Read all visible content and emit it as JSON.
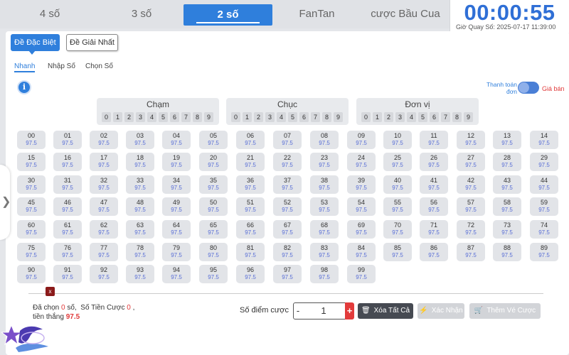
{
  "tabs": [
    "4 số",
    "3 số",
    "2 số",
    "FanTan",
    "cược Bầu Cua"
  ],
  "active_tab": "2 số",
  "timer": {
    "countdown": "00:00:55",
    "draw_time_label": "Giờ Quay Số: 2025-07-17 11:39:00"
  },
  "bet_types": {
    "special": "Đề Đặc Biệt",
    "first": "Đề Giải Nhất"
  },
  "sub_tabs": {
    "quick": "Nhanh",
    "enter": "Nhập Số",
    "choose": "Chọn Số"
  },
  "info_icon": "i",
  "payment": {
    "left_label": "Thanh toán đơn",
    "right_label": "Giá bán"
  },
  "digit_groups": [
    {
      "title": "Chạm",
      "digits": [
        "0",
        "1",
        "2",
        "3",
        "4",
        "5",
        "6",
        "7",
        "8",
        "9"
      ]
    },
    {
      "title": "Chục",
      "digits": [
        "0",
        "1",
        "2",
        "3",
        "4",
        "5",
        "6",
        "7",
        "8",
        "9"
      ]
    },
    {
      "title": "Đơn vị",
      "digits": [
        "0",
        "1",
        "2",
        "3",
        "4",
        "5",
        "6",
        "7",
        "8",
        "9"
      ]
    }
  ],
  "numbers": [
    "00",
    "01",
    "02",
    "03",
    "04",
    "05",
    "06",
    "07",
    "08",
    "09",
    "10",
    "11",
    "12",
    "13",
    "14",
    "15",
    "16",
    "17",
    "18",
    "19",
    "20",
    "21",
    "22",
    "23",
    "24",
    "25",
    "26",
    "27",
    "28",
    "29",
    "30",
    "31",
    "32",
    "33",
    "34",
    "35",
    "36",
    "37",
    "38",
    "39",
    "40",
    "41",
    "42",
    "43",
    "44",
    "45",
    "46",
    "47",
    "48",
    "49",
    "50",
    "51",
    "52",
    "53",
    "54",
    "55",
    "56",
    "57",
    "58",
    "59",
    "60",
    "61",
    "62",
    "63",
    "64",
    "65",
    "66",
    "67",
    "68",
    "69",
    "70",
    "71",
    "72",
    "73",
    "74",
    "75",
    "76",
    "77",
    "78",
    "79",
    "80",
    "81",
    "82",
    "83",
    "84",
    "85",
    "86",
    "87",
    "88",
    "89",
    "90",
    "91",
    "92",
    "93",
    "94",
    "95",
    "96",
    "97",
    "98",
    "99"
  ],
  "odds": "97.5",
  "close_label": "x",
  "summary": {
    "chosen_label": "Đã chọn",
    "chosen_count": "0",
    "chosen_unit": "số,",
    "amount_label": "Số Tiền Cược",
    "amount_value": "0",
    "amount_suffix": ",",
    "win_label": "tiền thắng",
    "win_value": "97.5"
  },
  "bet_points": {
    "label": "Số điểm cược",
    "minus": "-",
    "value": "1",
    "plus": "+"
  },
  "actions": {
    "clear_all": "Xóa Tất Cả",
    "confirm": "Xác Nhận",
    "add_to_ticket": "Thêm Vé Cược"
  },
  "side_toggle": "❯",
  "icons": {
    "info": "info-icon",
    "trash": "trash-icon",
    "lightning": "lightning-icon",
    "cart": "cart-icon",
    "chevron": "chevron-right-icon",
    "logo": "app-logo"
  },
  "colors": {
    "accent": "#2f7fdc",
    "timer": "#2f6fd6",
    "highlight_red": "#e03a3a",
    "odds": "#5a6fd6",
    "close_button": "#8b1a1a"
  }
}
